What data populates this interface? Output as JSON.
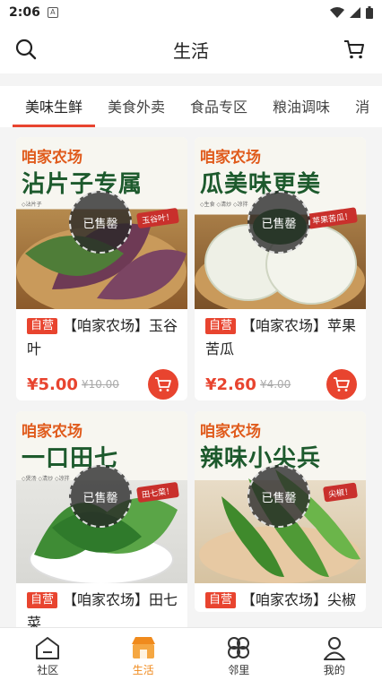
{
  "status": {
    "time": "2:06",
    "notif_icon": "A"
  },
  "header": {
    "title": "生活",
    "search_icon": "search-icon",
    "cart_icon": "cart-icon"
  },
  "tabs": [
    {
      "label": "美味生鲜",
      "active": true
    },
    {
      "label": "美食外卖",
      "active": false
    },
    {
      "label": "食品专区",
      "active": false
    },
    {
      "label": "粮油调味",
      "active": false
    },
    {
      "label": "消",
      "active": false
    }
  ],
  "products": [
    {
      "brand": "咱家农场",
      "headline": "沾片子专属",
      "img_sub": "◇沾片子",
      "img_tag": "玉谷叶！",
      "sold_label": "已售罄",
      "badge": "自营",
      "name": "【咱家农场】玉谷叶",
      "price": "¥5.00",
      "orig_price": "¥10.00",
      "bg": "#7a3f5a"
    },
    {
      "brand": "咱家农场",
      "headline": "瓜美味更美",
      "img_sub": "◇生食 ◇清炒 ◇凉拌",
      "img_tag": "苹果苦瓜！",
      "sold_label": "已售罄",
      "badge": "自营",
      "name": "【咱家农场】苹果苦瓜",
      "price": "¥2.60",
      "orig_price": "¥4.00",
      "bg": "#e9ece4"
    },
    {
      "brand": "咱家农场",
      "headline": "一口田七",
      "img_sub": "◇煲汤 ◇清炒 ◇凉拌",
      "img_tag": "田七菜！",
      "sold_label": "已售罄",
      "badge": "自营",
      "name": "【咱家农场】田七菜",
      "price": "",
      "orig_price": "",
      "bg": "#3d8a3a"
    },
    {
      "brand": "咱家农场",
      "headline": "辣味小尖兵",
      "img_sub": "",
      "img_tag": "尖椒！",
      "sold_label": "已售罄",
      "badge": "自营",
      "name": "【咱家农场】尖椒",
      "price": "",
      "orig_price": "",
      "bg": "#4f9a36"
    }
  ],
  "bottom_nav": [
    {
      "label": "社区",
      "icon": "community-icon",
      "active": false
    },
    {
      "label": "生活",
      "icon": "life-shop-icon",
      "active": true
    },
    {
      "label": "邻里",
      "icon": "neighbor-icon",
      "active": false
    },
    {
      "label": "我的",
      "icon": "profile-icon",
      "active": false
    }
  ],
  "colors": {
    "accent": "#e8442f",
    "nav_active": "#f08a1c",
    "brand_orange": "#e05b1c",
    "headline_green": "#1d5a2d"
  }
}
